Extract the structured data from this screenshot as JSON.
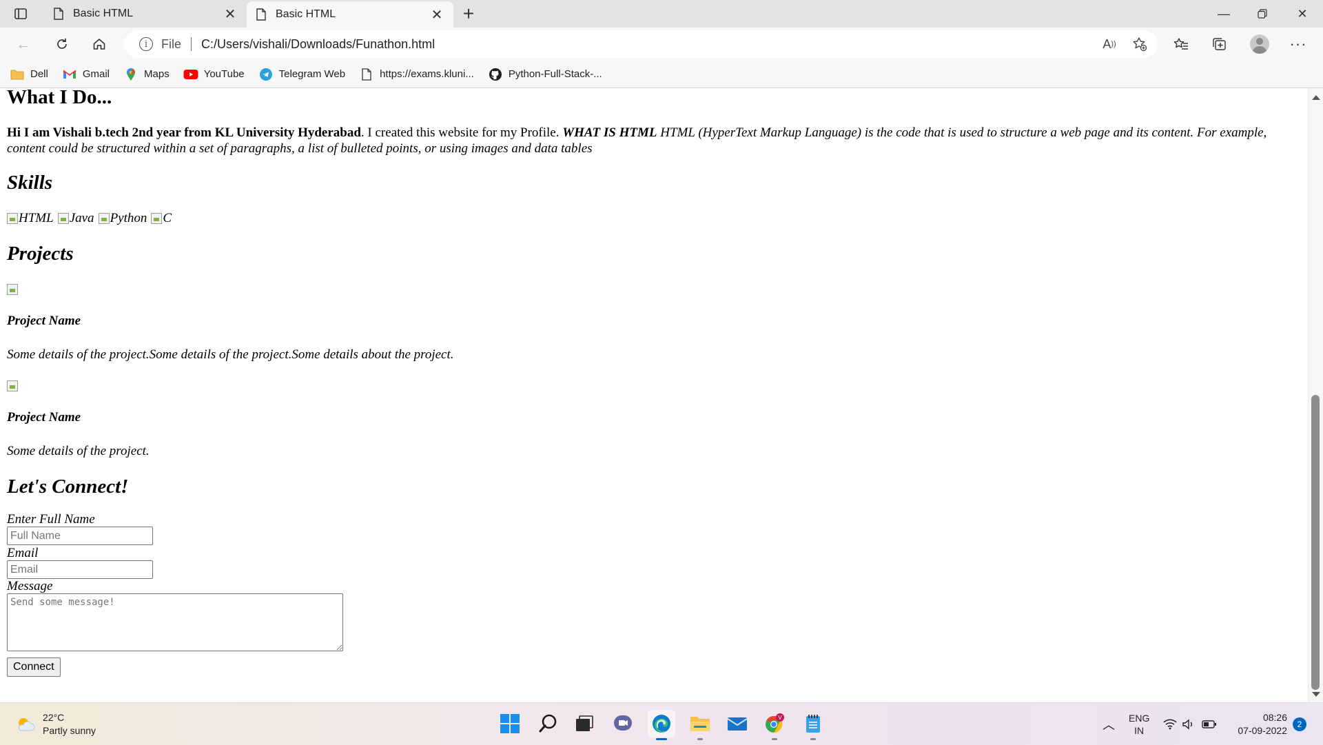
{
  "browser": {
    "tabs": [
      {
        "title": "Basic HTML",
        "active": false
      },
      {
        "title": "Basic HTML",
        "active": true
      }
    ],
    "address": {
      "scheme": "File",
      "url": "C:/Users/vishali/Downloads/Funathon.html"
    },
    "bookmarks": [
      {
        "label": "Dell",
        "icon": "folder-icon"
      },
      {
        "label": "Gmail",
        "icon": "gmail-icon"
      },
      {
        "label": "Maps",
        "icon": "maps-pin-icon"
      },
      {
        "label": "YouTube",
        "icon": "youtube-icon"
      },
      {
        "label": "Telegram Web",
        "icon": "telegram-icon"
      },
      {
        "label": "https://exams.kluni...",
        "icon": "page-icon"
      },
      {
        "label": "Python-Full-Stack-...",
        "icon": "github-icon"
      }
    ]
  },
  "page": {
    "heading_what": "What I Do...",
    "intro_bold": "Hi I am Vishali b.tech 2nd year from KL University Hyderabad",
    "intro_plain": ". I created this website for my Profile. ",
    "intro_bold_italic": "WHAT IS HTML",
    "intro_italic": " HTML (HyperText Markup Language) is the code that is used to structure a web page and its content. For example, content could be structured within a set of paragraphs, a list of bulleted points, or using images and data tables",
    "skills_heading": "Skills",
    "skills": [
      "HTML",
      "Java",
      "Python",
      "C"
    ],
    "projects_heading": "Projects",
    "projects": [
      {
        "name": "Project Name",
        "details": "Some details of the project.Some details of the project.Some details about the project."
      },
      {
        "name": "Project Name",
        "details": "Some details of the project."
      }
    ],
    "connect_heading": "Let's Connect!",
    "form": {
      "name_label": "Enter Full Name",
      "name_placeholder": "Full Name",
      "email_label": "Email",
      "email_placeholder": "Email",
      "message_label": "Message",
      "message_placeholder": "Send some message!",
      "submit_label": "Connect"
    }
  },
  "taskbar": {
    "weather_temp": "22°C",
    "weather_desc": "Partly sunny",
    "lang_top": "ENG",
    "lang_bottom": "IN",
    "time": "08:26",
    "date": "07-09-2022",
    "notification_count": "2",
    "chrome_profile_badge": "V"
  }
}
